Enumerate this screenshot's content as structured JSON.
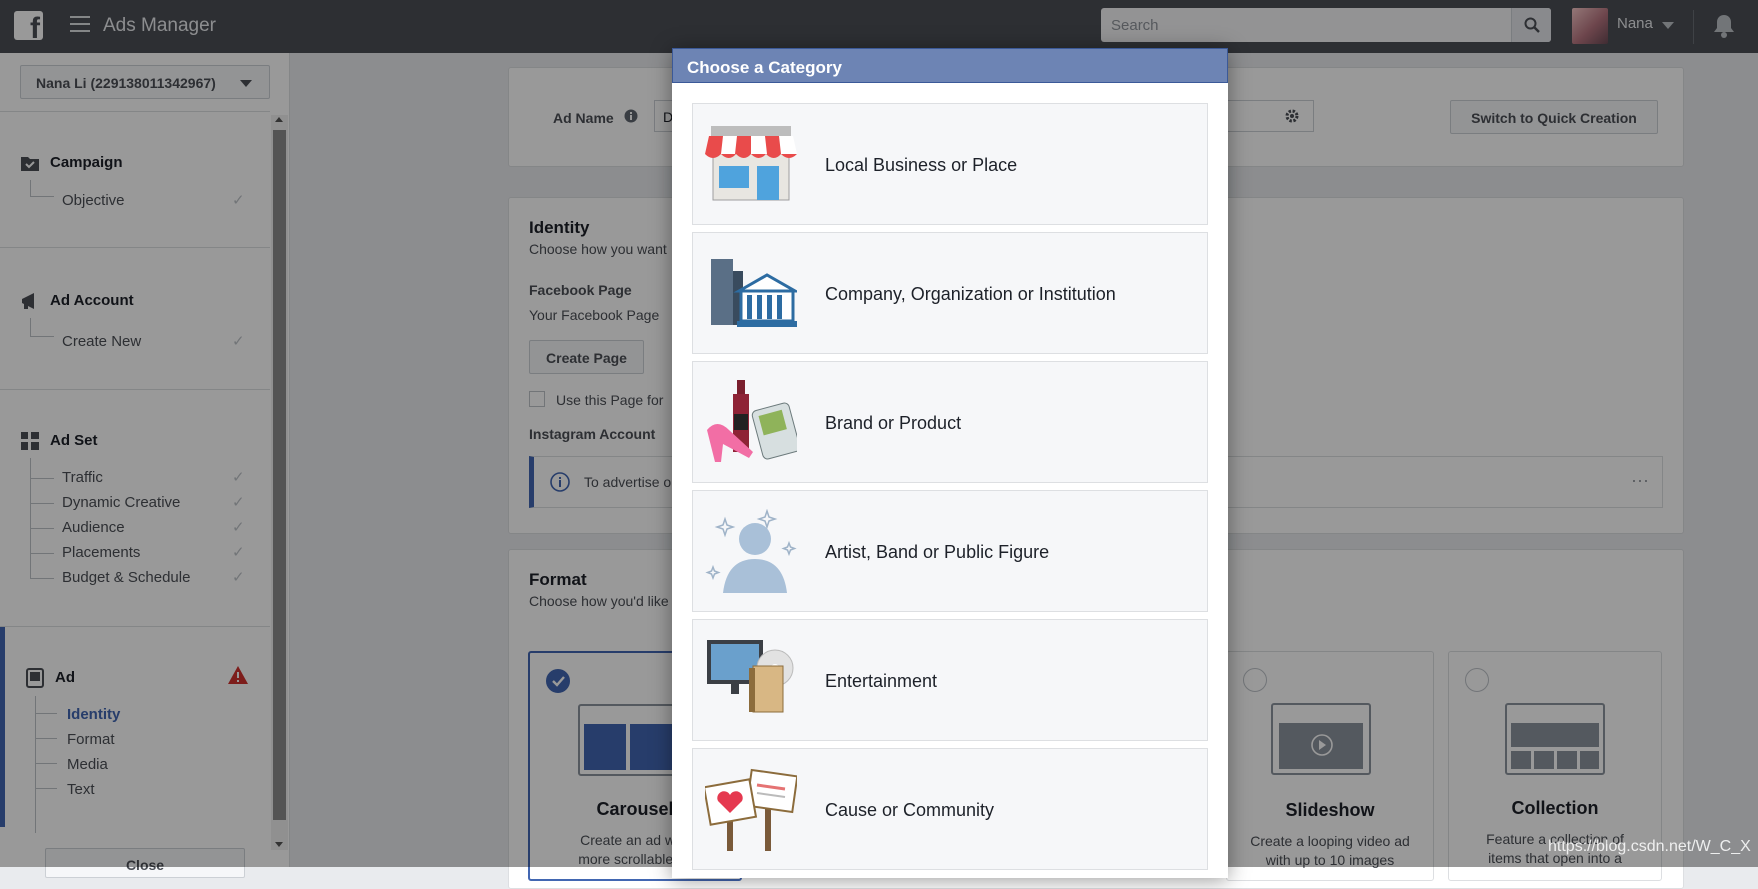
{
  "topbar": {
    "brand_glyph": "f",
    "app_title": "Ads Manager",
    "search_placeholder": "Search",
    "user_name": "Nana"
  },
  "leftnav": {
    "account": "Nana Li (229138011342967)",
    "sections": {
      "campaign": {
        "title": "Campaign",
        "items": [
          "Objective"
        ]
      },
      "ad_account": {
        "title": "Ad Account",
        "items": [
          "Create New"
        ]
      },
      "ad_set": {
        "title": "Ad Set",
        "items": [
          "Traffic",
          "Dynamic Creative",
          "Audience",
          "Placements",
          "Budget & Schedule"
        ]
      },
      "ad": {
        "title": "Ad",
        "items": [
          "Identity",
          "Format",
          "Media",
          "Text"
        ],
        "active_item": "Identity",
        "status": "warning"
      }
    },
    "close_label": "Close",
    "check_glyph": "✓"
  },
  "main": {
    "ad_name_label": "Ad Name",
    "ad_name_value": "D",
    "quick_creation_label": "Switch to Quick Creation",
    "identity": {
      "title": "Identity",
      "subtitle": "Choose how you want",
      "page_label": "Facebook Page",
      "page_text": "Your Facebook Page",
      "create_page_label": "Create Page",
      "use_page_label": "Use this Page for",
      "instagram_label": "Instagram Account",
      "info_text": "To advertise o",
      "more": "···"
    },
    "format": {
      "title": "Format",
      "subtitle": "Choose how you'd like",
      "options": [
        {
          "name": "Carousel",
          "desc": "Create an ad with\nmore scrollable im",
          "selected": true
        },
        {
          "name": "Slideshow",
          "desc": "Create a looping video ad\nwith up to 10 images",
          "selected": false
        },
        {
          "name": "Collection",
          "desc": "Feature a collection of\nitems that open into a",
          "selected": false
        }
      ]
    }
  },
  "modal": {
    "title": "Choose a Category",
    "categories": [
      {
        "label": "Local Business or Place",
        "icon": "storefront-icon"
      },
      {
        "label": "Company, Organization or Institution",
        "icon": "buildings-icon"
      },
      {
        "label": "Brand or Product",
        "icon": "products-icon"
      },
      {
        "label": "Artist, Band or Public Figure",
        "icon": "public-figure-icon"
      },
      {
        "label": "Entertainment",
        "icon": "entertainment-icon"
      },
      {
        "label": "Cause or Community",
        "icon": "community-signs-icon"
      }
    ]
  },
  "watermark": "https://blog.csdn.net/W_C_X",
  "colors": {
    "topbar": "#4b4f56",
    "modal_header": "#6d84b4",
    "accent": "#4267b2",
    "warning": "#d0312d"
  }
}
